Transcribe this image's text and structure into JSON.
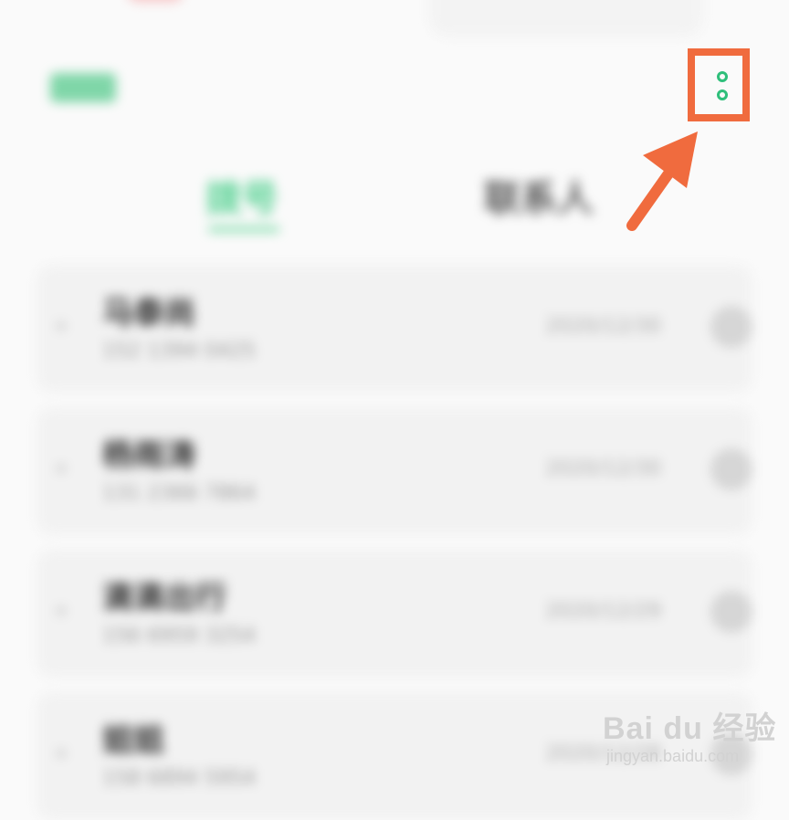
{
  "header": {
    "tag_label": "拨号",
    "more_icon": "more-vertical-icon"
  },
  "tabs": [
    {
      "label": "拨号",
      "active": true
    },
    {
      "label": "联系人",
      "active": false
    }
  ],
  "call_log": [
    {
      "name": "马泰尚",
      "phone": "152 1394 0425",
      "date": "2020/12/30"
    },
    {
      "name": "杨雨涛",
      "phone": "131 2366 7864",
      "date": "2020/12/30"
    },
    {
      "name": "滴滴出行",
      "phone": "156 6959 3254",
      "date": "2020/12/29"
    },
    {
      "name": "姐姐",
      "phone": "158 6894 5954",
      "date": "2020/12/28"
    }
  ],
  "annotation": {
    "color": "#f06b3e"
  },
  "watermark": {
    "brand": "Bai du 经验",
    "url": "jingyan.baidu.com"
  },
  "colors": {
    "accent": "#4fd08e",
    "annotation": "#f06b3e"
  }
}
